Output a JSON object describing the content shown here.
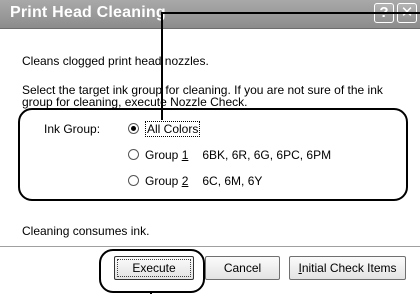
{
  "dialog": {
    "title": "Print Head Cleaning",
    "help_glyph": "?",
    "close_glyph": "✕"
  },
  "description": "Cleans clogged print head nozzles.",
  "instruction": "Select the target ink group for cleaning. If you are not sure of the ink group for cleaning, execute Nozzle Check.",
  "ink_group": {
    "label": "Ink Group:",
    "options": [
      {
        "label": "All Colors",
        "colors": "",
        "selected": true
      },
      {
        "label_prefix": "Group ",
        "label_number": "1",
        "colors": "6BK, 6R, 6G, 6PC, 6PM",
        "selected": false
      },
      {
        "label_prefix": "Group ",
        "label_number": "2",
        "colors": "6C, 6M, 6Y",
        "selected": false
      }
    ]
  },
  "note": "Cleaning consumes ink.",
  "buttons": {
    "execute": "Execute",
    "cancel": "Cancel",
    "initial_check_items_prefix": "I",
    "initial_check_items_rest": "nitial Check Items"
  }
}
